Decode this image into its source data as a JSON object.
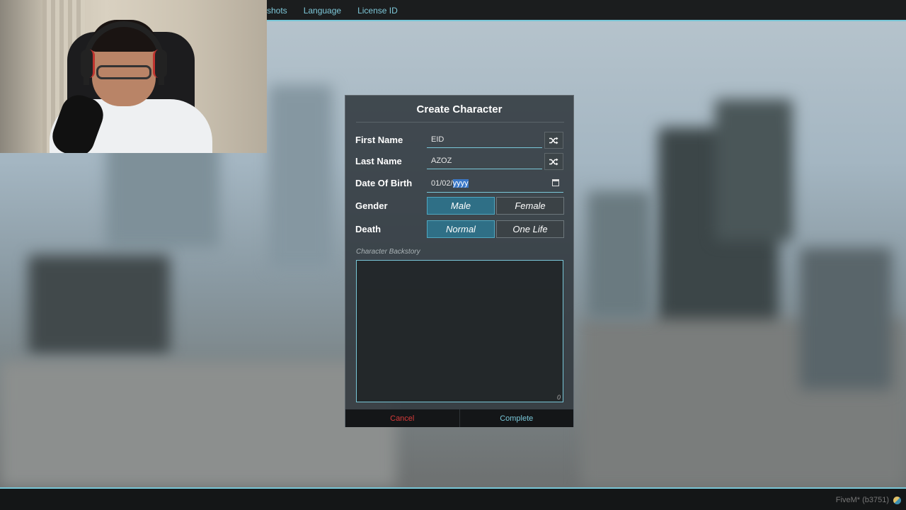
{
  "topnav": {
    "items": [
      "shots",
      "Language",
      "License ID"
    ]
  },
  "dialog": {
    "title": "Create Character",
    "first_name": {
      "label": "First Name",
      "value": "EID"
    },
    "last_name": {
      "label": "Last Name",
      "value": "AZOZ"
    },
    "dob": {
      "label": "Date Of Birth",
      "value_prefix": "01/02/",
      "value_selected": "yyyy"
    },
    "gender": {
      "label": "Gender",
      "options": [
        "Male",
        "Female"
      ],
      "selected": "Male"
    },
    "death": {
      "label": "Death",
      "options": [
        "Normal",
        "One Life"
      ],
      "selected": "Normal"
    },
    "backstory": {
      "label": "Character Backstory",
      "value": "",
      "count": "0"
    },
    "buttons": {
      "cancel": "Cancel",
      "complete": "Complete"
    }
  },
  "status": {
    "version": "FiveM* (b3751)"
  },
  "icons": [
    "shuffle-icon",
    "calendar-icon",
    "fivem-logo-icon"
  ],
  "colors": {
    "accent": "#79c7d8",
    "cancel": "#d63a3a",
    "active_option": "#2f6f86"
  }
}
